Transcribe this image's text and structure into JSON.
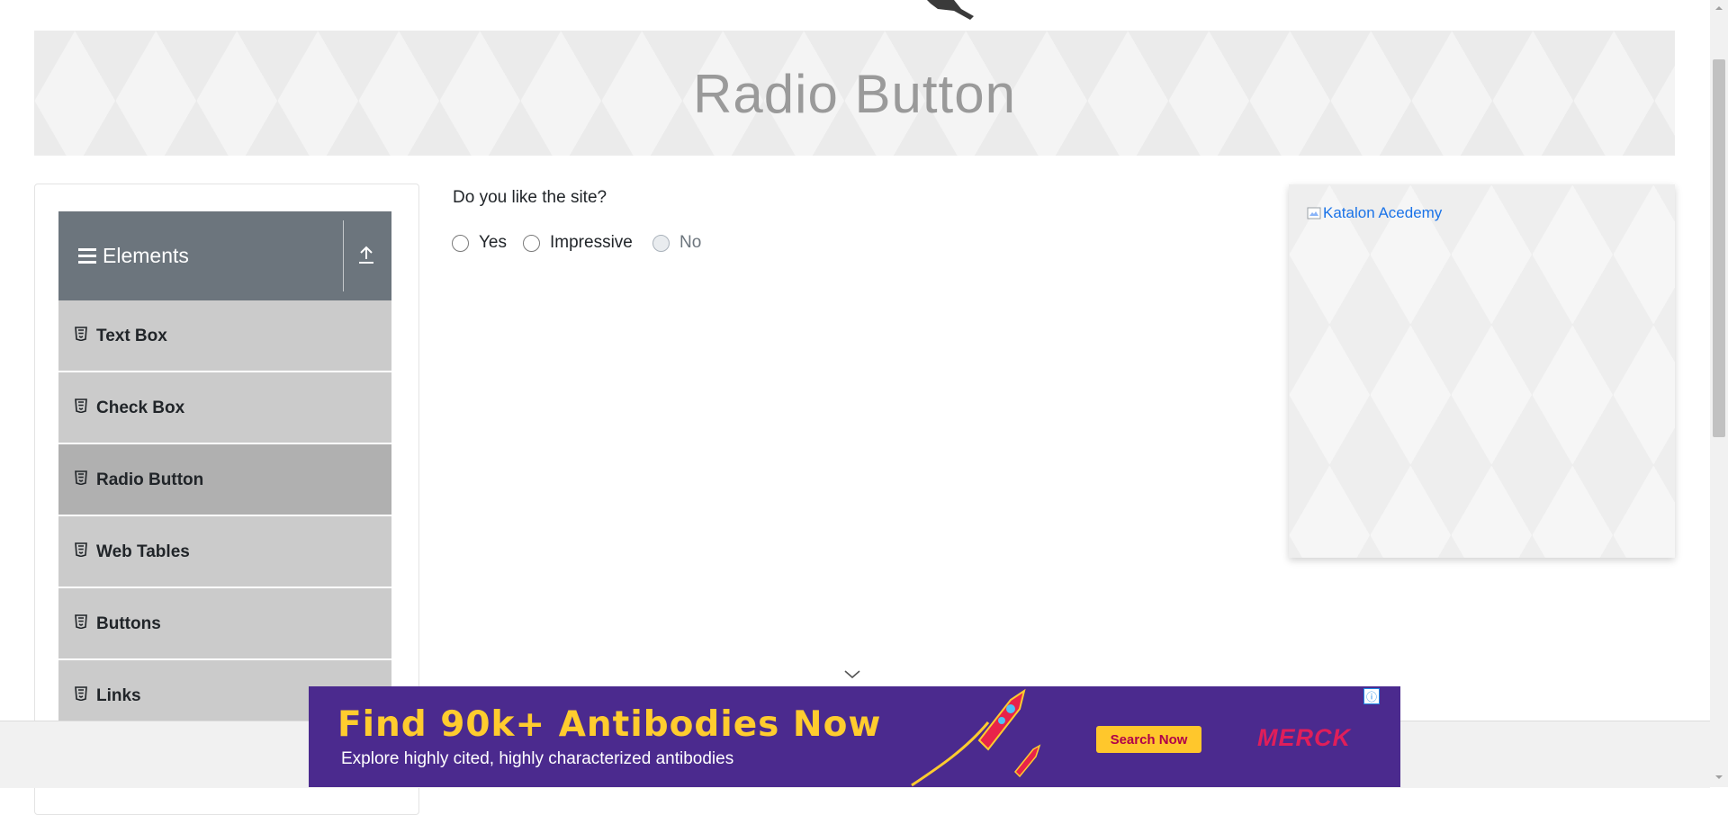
{
  "page": {
    "title": "Radio Button"
  },
  "sidebar": {
    "group_title": "Elements",
    "items": [
      {
        "label": "Text Box"
      },
      {
        "label": "Check Box"
      },
      {
        "label": "Radio Button",
        "active": true
      },
      {
        "label": "Web Tables"
      },
      {
        "label": "Buttons"
      },
      {
        "label": "Links"
      }
    ]
  },
  "form": {
    "question": "Do you like the site?",
    "options": [
      {
        "label": "Yes",
        "disabled": false,
        "checked": false
      },
      {
        "label": "Impressive",
        "disabled": false,
        "checked": false
      },
      {
        "label": "No",
        "disabled": true,
        "checked": false
      }
    ]
  },
  "side_ad": {
    "alt_text": "Katalon Acedemy"
  },
  "bottom_ad": {
    "headline": "Find 90k+ Antibodies Now",
    "subline": "Explore highly cited, highly characterized antibodies",
    "cta": "Search Now",
    "brand": "MERCK",
    "colors": {
      "background": "#4b2a8e",
      "headline": "#ffcc2e",
      "cta_bg": "#ffc72c",
      "brand": "#e01e5a"
    }
  },
  "colors": {
    "sidebar_header": "#6c757d",
    "menu_item": "#cbcbcb",
    "menu_item_active": "#b0b0b0"
  }
}
